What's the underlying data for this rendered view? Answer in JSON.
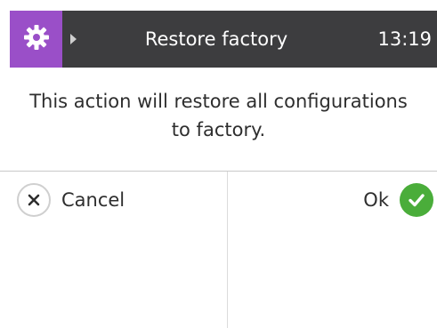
{
  "header": {
    "settings_icon": "gear-icon",
    "title": "Restore factory",
    "time": "13:19",
    "accent_color": "#9a4fc8",
    "bar_color": "#3d3d3f"
  },
  "dialog": {
    "message_line1": "This action will restore all configurations",
    "message_line2": "to factory."
  },
  "actions": {
    "cancel_label": "Cancel",
    "cancel_icon": "close-icon",
    "ok_label": "Ok",
    "ok_icon": "check-icon",
    "ok_color": "#4aad3a"
  }
}
